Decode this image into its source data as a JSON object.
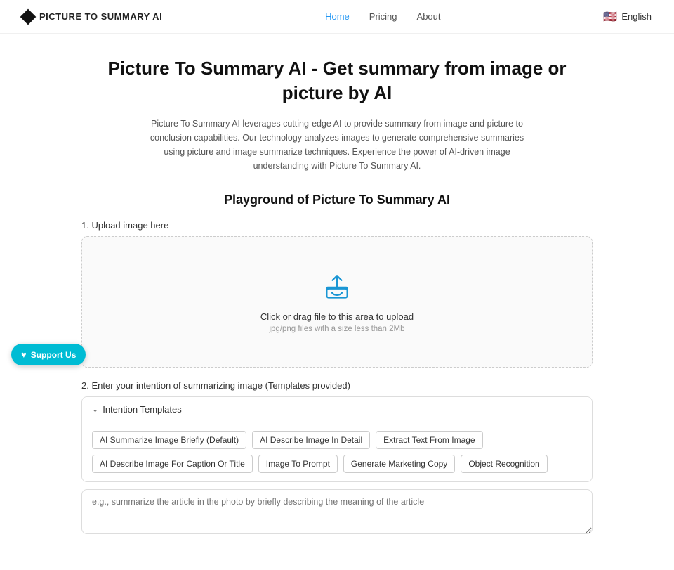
{
  "nav": {
    "logo_text": "PICTURE TO SUMMARY AI",
    "links": [
      {
        "label": "Home",
        "active": true
      },
      {
        "label": "Pricing",
        "active": false
      },
      {
        "label": "About",
        "active": false
      }
    ],
    "language": "English",
    "flag": "🇺🇸"
  },
  "hero": {
    "title": "Picture To Summary AI - Get summary from image or picture by AI",
    "subtitle": "Picture To Summary AI leverages cutting-edge AI to provide summary from image and picture to conclusion capabilities. Our technology analyzes images to generate comprehensive summaries using picture and image summarize techniques. Experience the power of AI-driven image understanding with Picture To Summary AI.",
    "playground_heading": "Playground of Picture To Summary AI"
  },
  "upload": {
    "section_label": "1. Upload image here",
    "click_text": "Click or drag file to this area to upload",
    "hint": "jpg/png files with a size less than 2Mb"
  },
  "intention": {
    "section_label": "2. Enter your intention of summarizing image (Templates provided)",
    "header_label": "Intention Templates",
    "pills": [
      "AI Summarize Image Briefly (Default)",
      "AI Describe Image In Detail",
      "Extract Text From Image",
      "AI Describe Image For Caption Or Title",
      "Image To Prompt",
      "Generate Marketing Copy",
      "Object Recognition"
    ],
    "textarea_placeholder": "e.g., summarize the article in the photo by briefly describing the meaning of the article"
  },
  "support": {
    "label": "Support Us"
  }
}
